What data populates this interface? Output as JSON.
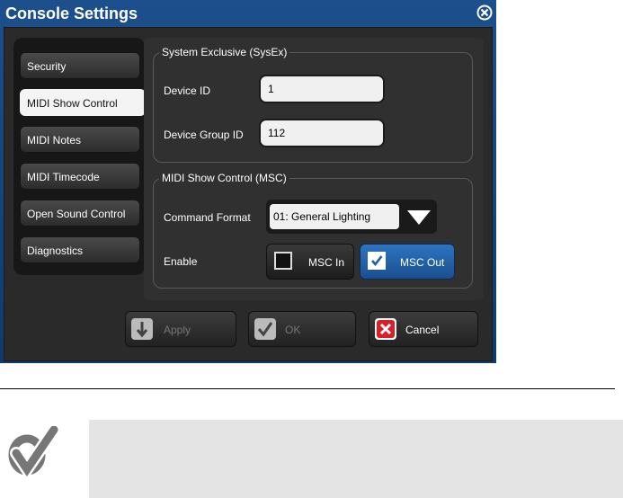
{
  "dialog": {
    "title": "Console Settings",
    "tabs": [
      {
        "label": "Security",
        "active": false
      },
      {
        "label": "MIDI Show Control",
        "active": true
      },
      {
        "label": "MIDI Notes",
        "active": false
      },
      {
        "label": "MIDI Timecode",
        "active": false
      },
      {
        "label": "Open Sound Control",
        "active": false
      },
      {
        "label": "Diagnostics",
        "active": false
      }
    ],
    "sysex": {
      "legend": "System Exclusive (SysEx)",
      "device_id_label": "Device ID",
      "device_id_value": "1",
      "device_group_id_label": "Device Group ID",
      "device_group_id_value": "112"
    },
    "msc": {
      "legend": "MIDI Show Control (MSC)",
      "command_format_label": "Command Format",
      "command_format_value": "01: General Lighting",
      "enable_label": "Enable",
      "msc_in_label": "MSC In",
      "msc_in_checked": false,
      "msc_out_label": "MSC Out",
      "msc_out_checked": true
    },
    "buttons": {
      "apply": "Apply",
      "ok": "OK",
      "cancel": "Cancel"
    }
  },
  "icons": {
    "close": "close-icon",
    "dropdown": "triangle-down-icon",
    "apply": "down-arrow-icon",
    "ok": "checkmark-icon",
    "cancel": "x-icon",
    "note": "checkmark-note-icon"
  },
  "colors": {
    "title_bar": "#1d4f8c",
    "selected_toggle": "#2563a8",
    "cancel_red": "#d8202a"
  }
}
